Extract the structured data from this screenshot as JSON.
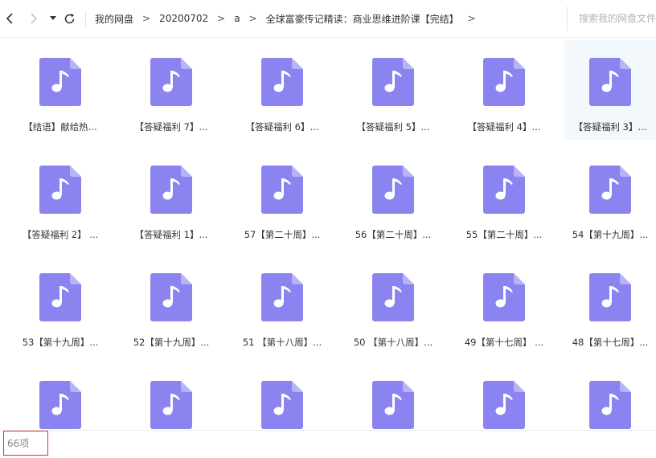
{
  "nav": {
    "back_icon": "chevron-left-icon",
    "forward_icon": "chevron-right-icon",
    "history_icon": "caret-down-icon",
    "refresh_icon": "refresh-icon",
    "crumb_separator": ">",
    "breadcrumbs": [
      "我的网盘",
      "20200702",
      "a",
      "全球富豪传记精读：商业思维进阶课【完结】"
    ],
    "trailing_separator": ">"
  },
  "search": {
    "placeholder": "搜索我的网盘文件"
  },
  "file_icon": {
    "name": "music-file-icon",
    "color": "#8b84f0",
    "fold_color": "#b8b3f7",
    "note_color": "#ffffff"
  },
  "files": [
    {
      "name": "【结语】献给热..."
    },
    {
      "name": "【答疑福利 7】..."
    },
    {
      "name": "【答疑福利 6】..."
    },
    {
      "name": "【答疑福利 5】..."
    },
    {
      "name": "【答疑福利 4】..."
    },
    {
      "name": "【答疑福利 3】...",
      "selected": true
    },
    {
      "name": "【答疑福利 2】 ..."
    },
    {
      "name": "【答疑福利 1】..."
    },
    {
      "name": "57【第二十周】..."
    },
    {
      "name": "56【第二十周】..."
    },
    {
      "name": "55【第二十周】..."
    },
    {
      "name": "54【第十九周】..."
    },
    {
      "name": "53【第十九周】..."
    },
    {
      "name": "52【第十九周】..."
    },
    {
      "name": "51 【第十八周】..."
    },
    {
      "name": "50 【第十八周】..."
    },
    {
      "name": "49【第十七周】 ..."
    },
    {
      "name": "48【第十七周】..."
    },
    {
      "name": ""
    },
    {
      "name": ""
    },
    {
      "name": ""
    },
    {
      "name": ""
    },
    {
      "name": ""
    },
    {
      "name": ""
    }
  ],
  "status": {
    "item_count": "66项",
    "highlight_color": "#e0322f"
  }
}
